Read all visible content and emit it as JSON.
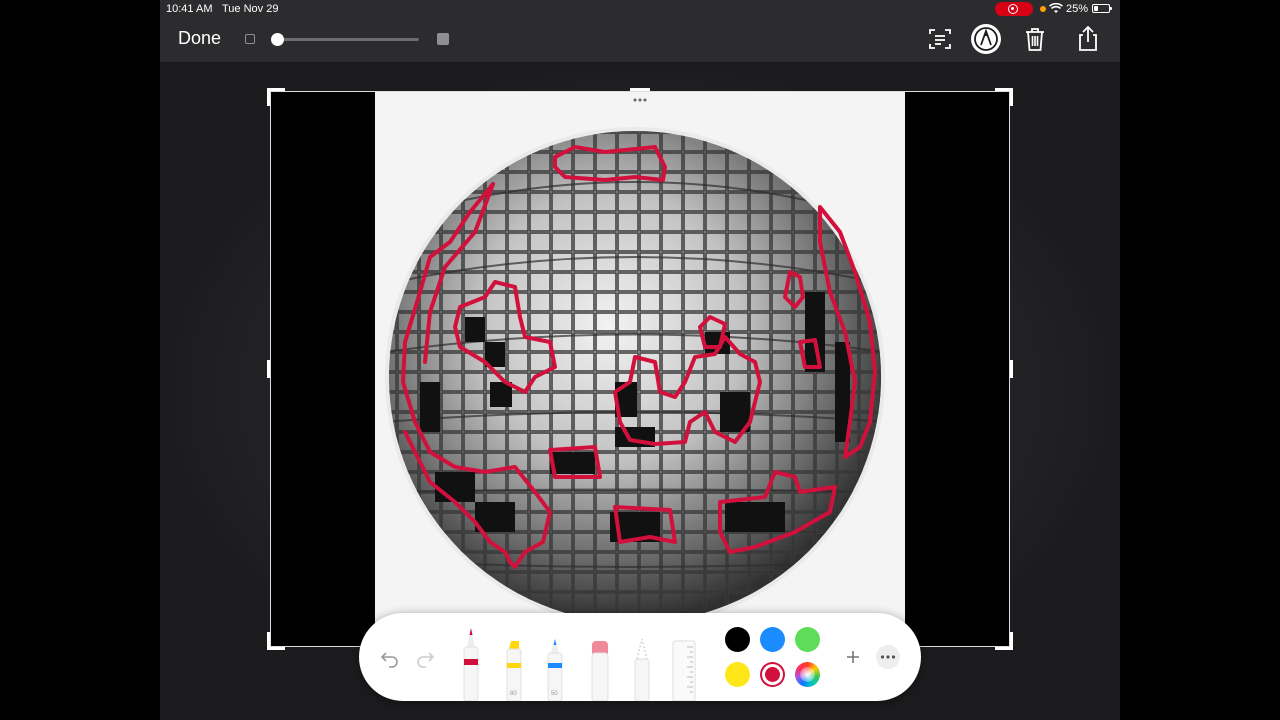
{
  "status_bar": {
    "time": "10:41 AM",
    "date": "Tue Nov 29",
    "battery": "25%"
  },
  "toolbar": {
    "done_label": "Done",
    "icons": [
      "text-recognition-icon",
      "markup-pen-icon",
      "trash-icon",
      "share-icon"
    ],
    "brush_size_fraction": 0.0
  },
  "image": {
    "subject": "mirror-disco-ball",
    "annotation_color": "#d2103c"
  },
  "palette": {
    "tools": [
      {
        "name": "pen",
        "accent": "#d2103c",
        "label": ""
      },
      {
        "name": "highlighter",
        "accent": "#ffd60a",
        "label": "80"
      },
      {
        "name": "pencil",
        "accent": "#1a8cff",
        "label": "50"
      },
      {
        "name": "eraser",
        "accent": "#f08a9a",
        "label": ""
      },
      {
        "name": "lasso",
        "accent": "#cccccc",
        "label": ""
      },
      {
        "name": "ruler",
        "accent": "#dddddd",
        "label": ""
      }
    ],
    "colors": [
      "#000000",
      "#1a8cff",
      "#5edc5a",
      "#ffe619",
      "#d2103c",
      "color-wheel"
    ],
    "selected_color": "#d2103c"
  }
}
